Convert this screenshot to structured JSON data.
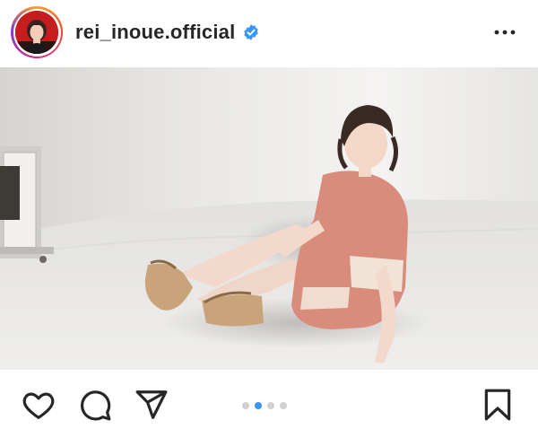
{
  "post": {
    "username": "rei_inoue.official",
    "verified": true,
    "more_icon": "ellipsis-horizontal-icon",
    "image_alt": "photo",
    "carousel": {
      "count": 4,
      "active_index": 1
    }
  },
  "colors": {
    "verified_blue": "#3897f0",
    "dot_active": "#3897f0",
    "dot_inactive": "#d0d0d0",
    "text": "#262626"
  },
  "actions": {
    "like_icon": "heart-icon",
    "comment_icon": "comment-bubble-icon",
    "share_icon": "paper-plane-icon",
    "save_icon": "bookmark-icon"
  }
}
